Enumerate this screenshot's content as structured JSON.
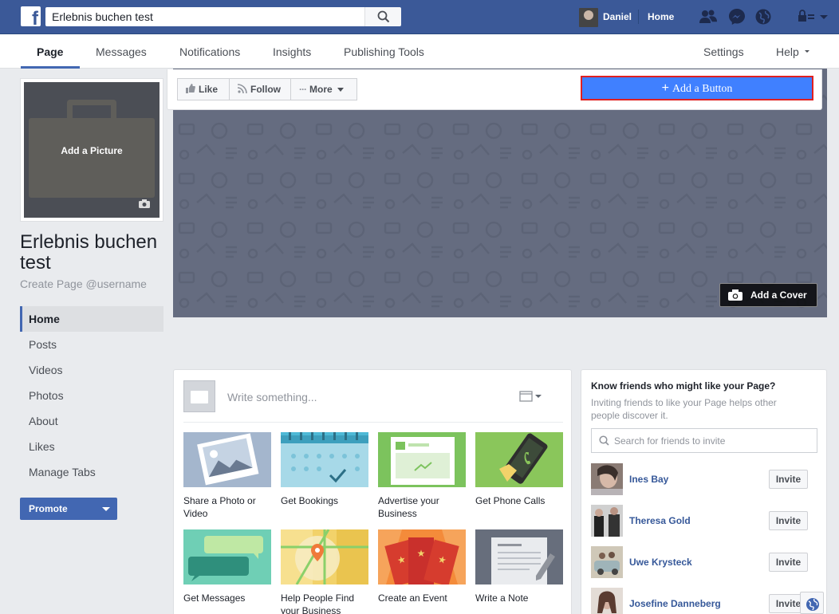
{
  "topbar": {
    "logo": "f",
    "search_value": "Erlebnis buchen test",
    "user_name": "Daniel",
    "home_label": "Home",
    "icons": [
      "friends-icon",
      "messenger-icon",
      "notifications-globe-icon",
      "privacy-lock-icon",
      "account-menu-icon"
    ]
  },
  "pagenav": {
    "tabs": [
      "Page",
      "Messages",
      "Notifications",
      "Insights",
      "Publishing Tools"
    ],
    "settings": "Settings",
    "help": "Help"
  },
  "profile": {
    "add_picture": "Add a Picture",
    "name": "Erlebnis buchen test",
    "username_link": "Create Page @username"
  },
  "leftnav": {
    "items": [
      "Home",
      "Posts",
      "Videos",
      "Photos",
      "About",
      "Likes",
      "Manage Tabs"
    ],
    "promote": "Promote"
  },
  "actions": {
    "like": "Like",
    "follow": "Follow",
    "more": "More",
    "add_button": "Add a Button",
    "add_cover": "Add a Cover"
  },
  "composer": {
    "placeholder": "Write something...",
    "tiles": [
      "Share a Photo or Video",
      "Get Bookings",
      "Advertise your Business",
      "Get Phone Calls",
      "Get Messages",
      "Help People Find your Business",
      "Create an Event",
      "Write a Note"
    ]
  },
  "invite": {
    "title": "Know friends who might like your Page?",
    "description": "Inviting friends to like your Page helps other people discover it.",
    "search_placeholder": "Search for friends to invite",
    "invite_label": "Invite",
    "friends": [
      "Ines Bay",
      "Theresa Gold",
      "Uwe Krysteck",
      "Josefine Danneberg"
    ]
  },
  "colors": {
    "brand_blue": "#3b5998",
    "button_blue": "#4267b2",
    "add_button_blue": "#4080ff",
    "highlight_red": "#e02020",
    "cover_gray": "#656c80"
  }
}
